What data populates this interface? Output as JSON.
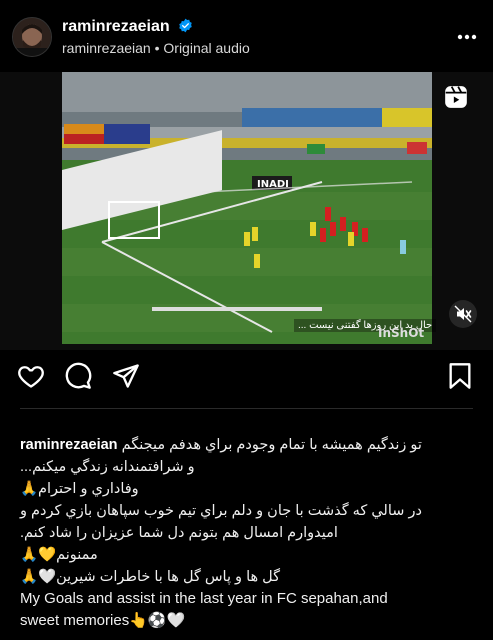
{
  "post": {
    "username": "raminrezaeian",
    "subtitle": "raminrezaeian • Original audio",
    "icons": {
      "verified": "verified-badge-icon",
      "more": "more-options-icon",
      "reel": "reels-icon",
      "mute": "muted-speaker-icon",
      "like": "heart-icon",
      "comment": "comment-icon",
      "share": "send-icon",
      "save": "bookmark-icon"
    }
  },
  "video": {
    "overlay_text": "حال بد این روزها گفتنی نیست ...",
    "watermark": "InShOt",
    "board_ad": "INADI"
  },
  "caption": {
    "username": "raminrezaeian",
    "line1": "تو زندگیم همیشه با تمام وجودم براي هدفم میجنگم",
    "line2": "و شرافتمندانه زندگي ميكنم...",
    "line3": "وفاداري و احترام🙏",
    "line4": "در سالي كه گذشت با جان و دلم براي تيم خوب سپاهان بازي كردم و",
    "line5": "اميدوارم امسال هم بتونم دل شما عزيزان را شاد كنم.",
    "line6": "ممنونم💛🙏",
    "line7": "گل ها و پاس گل ها با خاطرات شيرين🤍🙏",
    "line8": "My Goals and assist in the last year in FC sepahan,and",
    "line9": "sweet memories👆⚽🤍"
  }
}
